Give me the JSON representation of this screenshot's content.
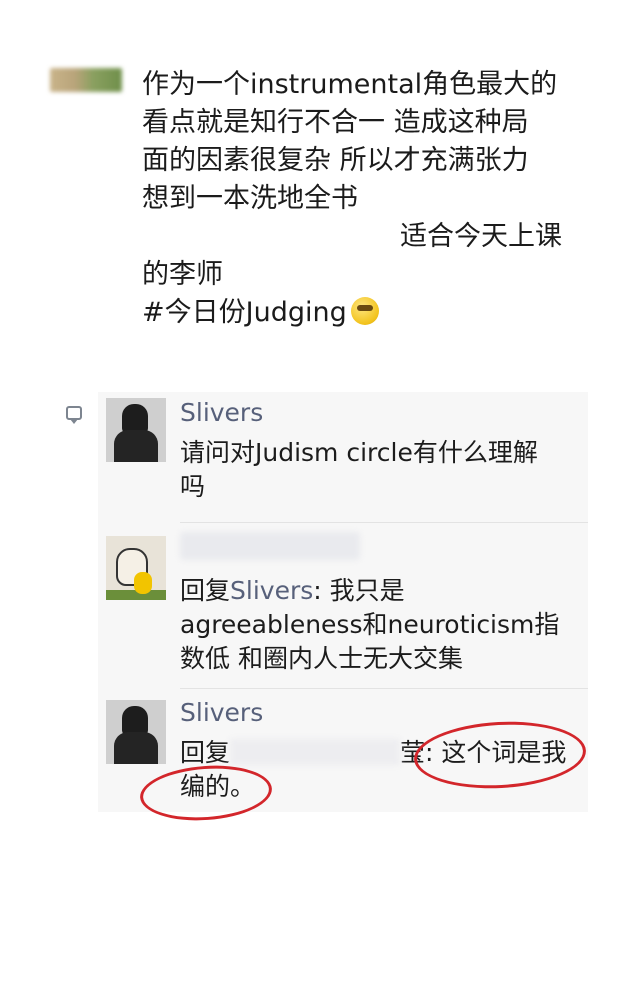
{
  "post": {
    "line1": "作为一个instrumental角色最大的",
    "line2": "看点就是知行不合一 造成这种局",
    "line3": "面的因素很复杂 所以才充满张力",
    "line4": "想到一本洗地全书",
    "line5": "适合今天上课",
    "line6": "的李师",
    "line7": "#今日份Judging"
  },
  "emoji": "thinking-face",
  "comments": [
    {
      "name": "Slivers",
      "lines": [
        "请问对Judism circle有什么理解",
        "吗"
      ]
    },
    {
      "reply_prefix": "回复",
      "reply_target": "Slivers",
      "reply_rest": ": 我只是",
      "lines": [
        "agreeableness和neuroticism指",
        "数低 和圈内人士无大交集"
      ]
    },
    {
      "name": "Slivers",
      "reply_prefix": "回复",
      "reply_tail": "莹: ",
      "reply_highlight": "这个词是我",
      "line2": "编的。"
    }
  ],
  "colors": {
    "name": "#57607a",
    "annotation": "#d3262b",
    "comment_bg": "#f7f7f7"
  }
}
